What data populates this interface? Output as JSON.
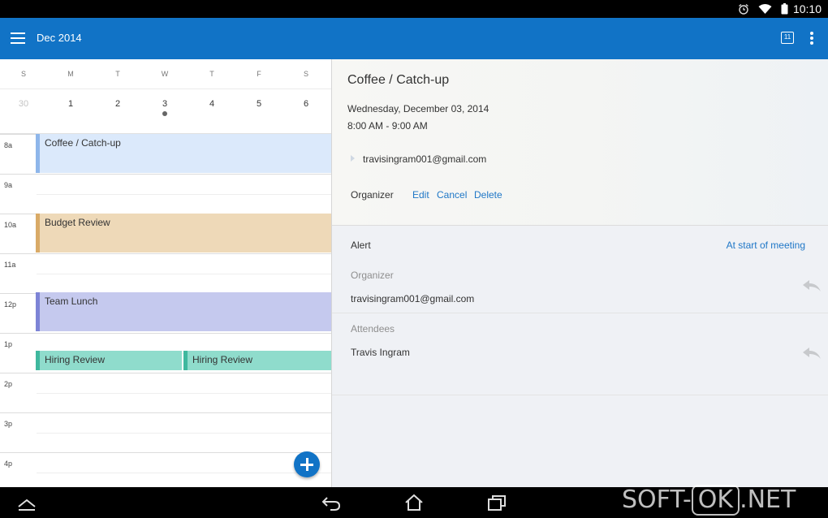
{
  "status_bar": {
    "time": "10:10",
    "icons": [
      "alarm-icon",
      "wifi-icon",
      "battery-icon"
    ]
  },
  "app_bar": {
    "title": "Dec 2014",
    "today_badge": "11",
    "color": "#1173c6"
  },
  "week": {
    "days_of_week": [
      "S",
      "M",
      "T",
      "W",
      "T",
      "F",
      "S"
    ],
    "dates": [
      "30",
      "1",
      "2",
      "3",
      "4",
      "5",
      "6"
    ],
    "muted_dates": [
      "30"
    ],
    "dot_dates": [
      "3"
    ]
  },
  "hours": [
    "8a",
    "9a",
    "10a",
    "11a",
    "12p",
    "1p",
    "2p",
    "3p",
    "4p"
  ],
  "events": [
    {
      "title": "Coffee / Catch-up",
      "color": "#dbe9fb",
      "accent": "#8eb6ea"
    },
    {
      "title": "Budget Review",
      "color": "#eed9b8",
      "accent": "#d9aa67"
    },
    {
      "title": "Team Lunch",
      "color": "#c5c9ee",
      "accent": "#7d84d6"
    },
    {
      "title": "Hiring Review",
      "color": "#8fdccc",
      "accent": "#3fb89e"
    },
    {
      "title": "Hiring Review",
      "color": "#8fdccc",
      "accent": "#3fb89e"
    }
  ],
  "detail": {
    "title": "Coffee / Catch-up",
    "date": "Wednesday, December 03, 2014",
    "time": "8:00 AM - 9:00 AM",
    "organizer_email": "travisingram001@gmail.com",
    "organizer_label": "Organizer",
    "actions": [
      "Edit",
      "Cancel",
      "Delete"
    ],
    "alert_label": "Alert",
    "alert_value": "At start of meeting",
    "organizer_section_label": "Organizer",
    "organizer_section_value": "travisingram001@gmail.com",
    "attendees_label": "Attendees",
    "attendee": "Travis Ingram"
  },
  "watermark": {
    "prefix": "SOFT-",
    "box": "OK",
    "suffix": ".NET"
  }
}
